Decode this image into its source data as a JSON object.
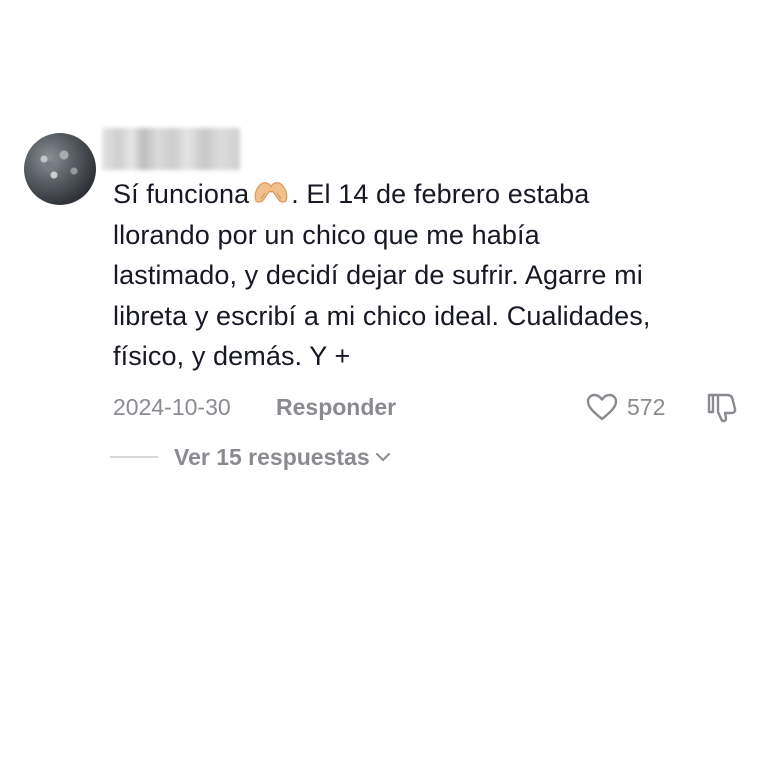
{
  "comment": {
    "text_lines": [
      "Sí funciona",
      ". El 14 de febrero estaba",
      "llorando por un chico que me había",
      "lastimado, y decidí dejar de sufrir. Agarre mi",
      "libreta y escribí a mi chico ideal. Cualidades,",
      "físico, y demás. Y +"
    ],
    "emoji": "heart-hands-emoji",
    "date": "2024-10-30",
    "reply_label": "Responder",
    "like_count": "572",
    "view_replies_label": "Ver 15 respuestas"
  },
  "icons": {
    "avatar": "avatar",
    "like": "heart-icon",
    "dislike": "dislike-icon",
    "expand": "chevron-down-icon"
  },
  "colors": {
    "text": "#161823",
    "secondary": "#8a8b91",
    "emoji": "#f2b97e"
  }
}
